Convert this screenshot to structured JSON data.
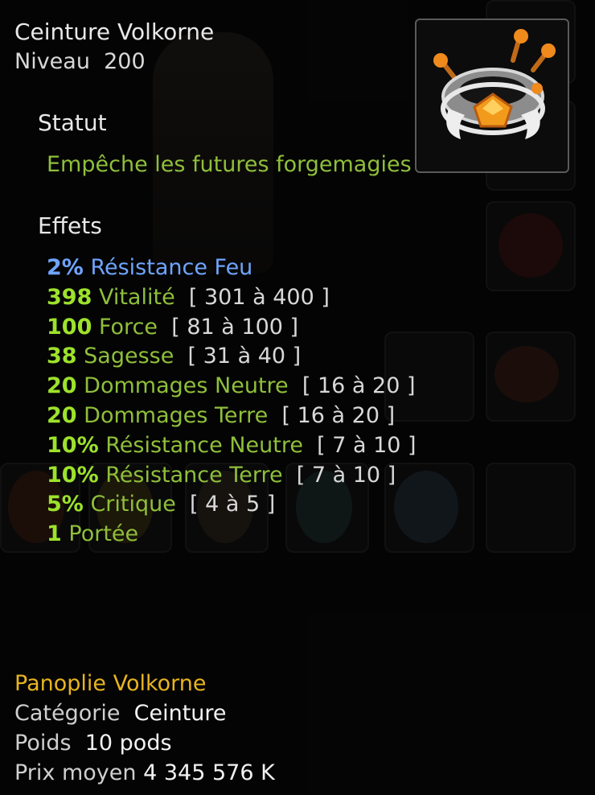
{
  "item": {
    "name": "Ceinture Volkorne",
    "level_label": "Niveau",
    "level": "200",
    "icon": "belt-icon"
  },
  "status": {
    "heading": "Statut",
    "text": "Empêche les futures forgemagies"
  },
  "effects": {
    "heading": "Effets",
    "items": [
      {
        "value": "2%",
        "name": "Résistance Feu",
        "range": "",
        "color": "#6fa4ff"
      },
      {
        "value": "398",
        "name": "Vitalité",
        "range": "[ 301 à 400 ]",
        "color": "#9de22b"
      },
      {
        "value": "100",
        "name": "Force",
        "range": "[ 81 à 100 ]",
        "color": "#9de22b"
      },
      {
        "value": "38",
        "name": "Sagesse",
        "range": "[ 31 à 40 ]",
        "color": "#9de22b"
      },
      {
        "value": "20",
        "name": "Dommages Neutre",
        "range": "[ 16 à 20 ]",
        "color": "#9de22b"
      },
      {
        "value": "20",
        "name": "Dommages Terre",
        "range": "[ 16 à 20 ]",
        "color": "#9de22b"
      },
      {
        "value": "10%",
        "name": "Résistance Neutre",
        "range": "[ 7 à 10 ]",
        "color": "#9de22b"
      },
      {
        "value": "10%",
        "name": "Résistance Terre",
        "range": "[ 7 à 10 ]",
        "color": "#9de22b"
      },
      {
        "value": "5%",
        "name": "Critique",
        "range": "[ 4 à 5 ]",
        "color": "#9de22b"
      },
      {
        "value": "1",
        "name": "Portée",
        "range": "",
        "color": "#9de22b"
      }
    ]
  },
  "footer": {
    "set_name": "Panoplie Volkorne",
    "category_label": "Catégorie",
    "category": "Ceinture",
    "weight_label": "Poids",
    "weight": "10 pods",
    "price_label": "Prix moyen",
    "price": "4 345 576 K"
  }
}
